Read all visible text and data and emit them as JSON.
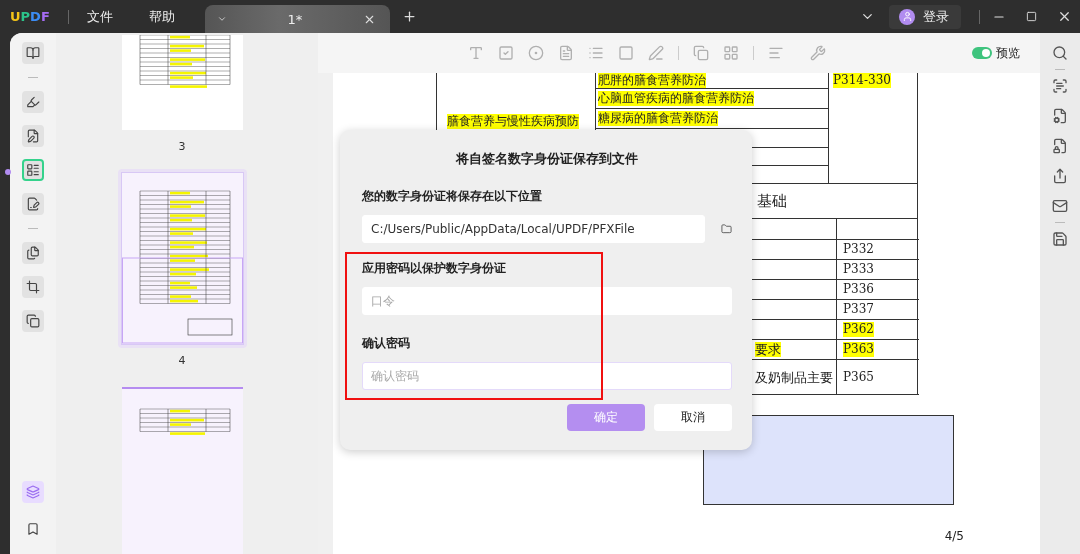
{
  "title_bar": {
    "logo": [
      "U",
      "P",
      "D",
      "F"
    ],
    "menu": [
      "文件",
      "帮助"
    ],
    "tab": {
      "title": "1*"
    },
    "login": "登录"
  },
  "tool_groups": [
    {
      "tools": [
        {
          "kind": "reader",
          "selected": false
        }
      ]
    },
    {
      "tools": [
        {
          "kind": "highlight",
          "selected": false
        },
        {
          "kind": "edit",
          "selected": false
        },
        {
          "kind": "form",
          "selected": true
        },
        {
          "kind": "sign",
          "selected": false
        }
      ]
    },
    {
      "tools": [
        {
          "kind": "pages",
          "selected": false
        },
        {
          "kind": "crop",
          "selected": false
        },
        {
          "kind": "copy",
          "selected": false
        }
      ]
    }
  ],
  "bottom_tools": [
    {
      "kind": "layers",
      "selected": true
    },
    {
      "kind": "bookmark",
      "selected": false
    }
  ],
  "thumbnails": [
    {
      "label": "3",
      "selected": false,
      "kind": "table"
    },
    {
      "label": "4",
      "selected": true,
      "kind": "full"
    },
    {
      "selected": false,
      "kind": "short"
    }
  ],
  "toolbar": {
    "preview": {
      "label": "预览",
      "on": true
    }
  },
  "document": {
    "group": {
      "text": "膳食营养与慢性疾病预防",
      "highlighted": true
    },
    "top_rows": [
      {
        "text": "肥胖的膳食营养防治",
        "highlighted": true
      },
      {
        "text": "心脑血管疾病的膳食营养防治",
        "highlighted": true
      },
      {
        "text": "糖尿病的膳食营养防治",
        "highlighted": true
      }
    ],
    "pages": {
      "text": "P314-330",
      "highlighted": true
    },
    "section": "基础",
    "rows": [
      {
        "page": "P332",
        "highlighted": false
      },
      {
        "page": "P333",
        "highlighted": false
      },
      {
        "page": "P336",
        "highlighted": false
      },
      {
        "page": "P337",
        "highlighted": false
      },
      {
        "page": "P362",
        "highlighted": true
      },
      {
        "detail": "要求",
        "page": "P363",
        "highlighted": true
      },
      {
        "detail": "及奶制品主要",
        "page": "P365",
        "highlighted": false
      }
    ]
  },
  "dialog": {
    "title": "将自签名数字身份证保存到文件",
    "location_label": "您的数字身份证将保存在以下位置",
    "path": "C:/Users/Public/AppData/Local/UPDF/PFXFile",
    "password_label": "应用密码以保护数字身份证",
    "password_placeholder": "口令",
    "confirm_label": "确认密码",
    "confirm_placeholder": "确认密码",
    "buttons": [
      {
        "label": "确定",
        "disabled": true
      },
      {
        "label": "取消",
        "disabled": false
      }
    ]
  },
  "page_indicator": "4/5"
}
